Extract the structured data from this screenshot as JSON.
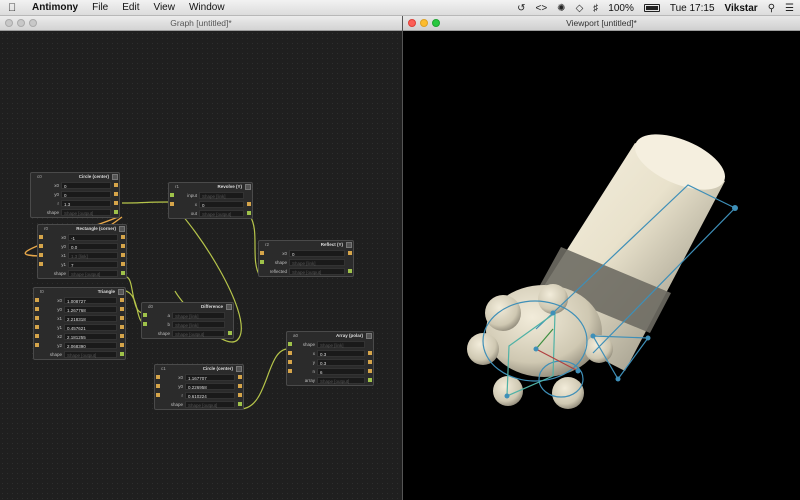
{
  "menubar": {
    "apple": "",
    "app_name": "Antimony",
    "menus": [
      "File",
      "Edit",
      "View",
      "Window"
    ],
    "battery": "100%",
    "clock": "Tue 17:15",
    "user": "Vikstar"
  },
  "graph_window": {
    "title": "Graph [untitled]*"
  },
  "viewport_window": {
    "title": "Viewport [untitled]*"
  },
  "nodes": {
    "circle_c0": {
      "name": "c0",
      "title": "Circle (center)",
      "rows": [
        {
          "label": "x0",
          "value": "0"
        },
        {
          "label": "y0",
          "value": "0"
        },
        {
          "label": "r",
          "value": "1.3"
        },
        {
          "label": "shape",
          "value": "Shape [output]"
        }
      ]
    },
    "rect_r0": {
      "name": "r0",
      "title": "Rectangle (corner)",
      "rows": [
        {
          "label": "x0",
          "value": "-1"
        },
        {
          "label": "y0",
          "value": "0.0"
        },
        {
          "label": "x1",
          "value": "1.3 [link]"
        },
        {
          "label": "y1",
          "value": "7"
        },
        {
          "label": "shape",
          "value": "Shape [output]"
        }
      ]
    },
    "revolve_r1": {
      "name": "r1",
      "title": "Revolve (Y)",
      "rows": [
        {
          "label": "input",
          "value": "Shape [link]"
        },
        {
          "label": "x",
          "value": "0"
        },
        {
          "label": "out",
          "value": "Shape [output]"
        }
      ]
    },
    "reflect_r2": {
      "name": "r2",
      "title": "Reflect (Y)",
      "rows": [
        {
          "label": "x0",
          "value": "0"
        },
        {
          "label": "shape",
          "value": "Shape [link]"
        },
        {
          "label": "reflected",
          "value": "Shape [output]"
        }
      ]
    },
    "triangle_t0": {
      "name": "t0",
      "title": "Triangle",
      "rows": [
        {
          "label": "x0",
          "value": "1.008727"
        },
        {
          "label": "y0",
          "value": "1.267768"
        },
        {
          "label": "x1",
          "value": "2.218318"
        },
        {
          "label": "y1",
          "value": "0.457621"
        },
        {
          "label": "x2",
          "value": "2.181255"
        },
        {
          "label": "y2",
          "value": "2.068390"
        },
        {
          "label": "shape",
          "value": "Shape [output]"
        }
      ]
    },
    "difference_d0": {
      "name": "d0",
      "title": "Difference",
      "rows": [
        {
          "label": "a",
          "value": "Shape [link]"
        },
        {
          "label": "b",
          "value": "Shape [link]"
        },
        {
          "label": "shape",
          "value": "Shape [output]"
        }
      ]
    },
    "circle_c1": {
      "name": "c1",
      "title": "Circle (center)",
      "rows": [
        {
          "label": "x0",
          "value": "1.167707"
        },
        {
          "label": "y0",
          "value": "0.226958"
        },
        {
          "label": "r",
          "value": "0.610224"
        },
        {
          "label": "shape",
          "value": "Shape [output]"
        }
      ]
    },
    "array_a0": {
      "name": "a0",
      "title": "Array (polar)",
      "rows": [
        {
          "label": "shape",
          "value": "Shape [link]"
        },
        {
          "label": "x",
          "value": "0.3"
        },
        {
          "label": "y",
          "value": "0.3"
        },
        {
          "label": "n",
          "value": "6"
        },
        {
          "label": "array",
          "value": "Shape [output]"
        }
      ]
    }
  },
  "colors": {
    "wire": "#b6c54a",
    "wire_selected": "#e6a74a",
    "port": "#d6a54a",
    "gizmo": "#3e8fb8"
  }
}
